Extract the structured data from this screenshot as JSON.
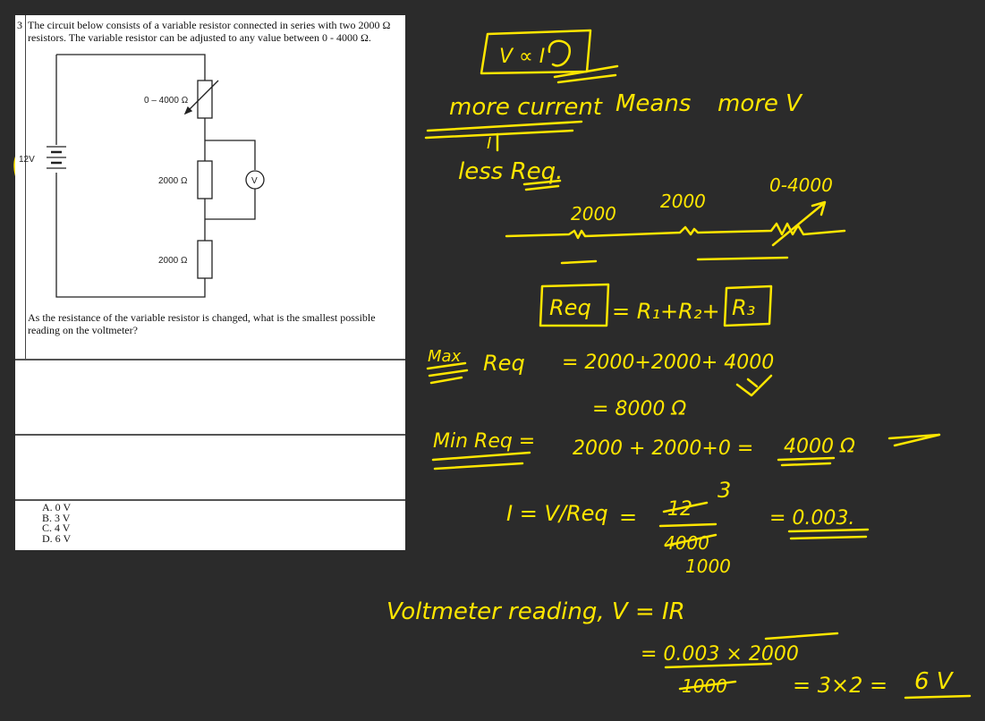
{
  "question": {
    "number": "3",
    "text": "The circuit below consists of a variable resistor connected in series with two 2000 Ω resistors. The variable resistor can be adjusted to any value between 0 - 4000 Ω.",
    "prompt": "As the resistance of the variable resistor is changed, what is the smallest possible reading on the voltmeter?",
    "options": [
      "A.  0 V",
      "B.  3 V",
      "C.  4 V",
      "D.  6 V"
    ]
  },
  "circuit": {
    "battery_label": "12V",
    "variable_resistor_label": "0 – 4000 Ω",
    "resistor_1_label": "2000 Ω",
    "resistor_2_label": "2000 Ω",
    "voltmeter_label": "V"
  },
  "notes": {
    "box_top": "V ∝ I",
    "line1_a": "more current",
    "line1_b": "Means",
    "line1_c": "more V",
    "arrow_i": "I",
    "line2": "less Req.",
    "r1_label": "2000",
    "r2_label": "2000",
    "r3_label": "0-4000",
    "formula_lhs": "Req",
    "formula_rhs_a": "= R₁+R₂+",
    "formula_rhs_b": "R₃",
    "max_label": "Max",
    "max_req": "Req",
    "max_sum": "= 2000+2000+ 4000",
    "max_total": "= 8000 Ω",
    "min_label": "Min Req =",
    "min_sum": "2000 + 2000+0 =",
    "min_total": "4000 Ω",
    "current_lhs": "I = V/Req",
    "current_eq": "=",
    "frac_num": "12",
    "frac_small": "3",
    "frac_den": "4000",
    "frac_den2": "1000",
    "current_result": "= 0.003.",
    "volt_line": "Voltmeter reading, V = IR",
    "volt_calc": "= 0.003 × 2000",
    "volt_den": "1000",
    "volt_final_a": "= 3×2 =",
    "volt_final_b": "6 V"
  }
}
